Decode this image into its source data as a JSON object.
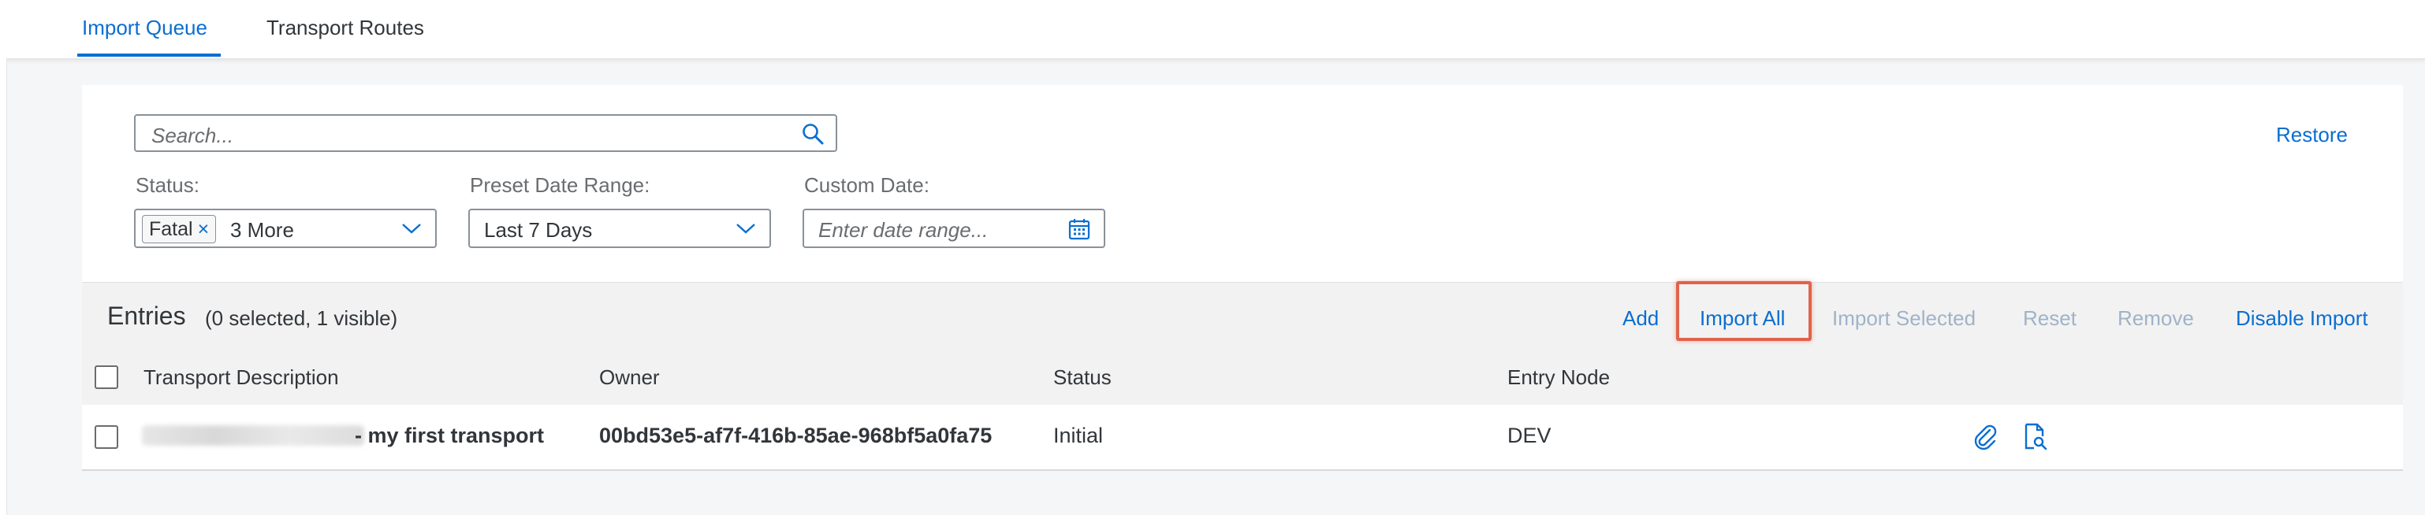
{
  "tabs": {
    "import_queue": "Import Queue",
    "transport_routes": "Transport Routes"
  },
  "filters": {
    "search_placeholder": "Search...",
    "restore": "Restore",
    "status_label": "Status:",
    "status_token": "Fatal",
    "status_token_remove": "×",
    "status_more": "3 More",
    "preset_label": "Preset Date Range:",
    "preset_value": "Last 7 Days",
    "custom_label": "Custom Date:",
    "custom_placeholder": "Enter date range..."
  },
  "entries": {
    "title": "Entries",
    "count": "(0 selected, 1 visible)",
    "actions": {
      "add": "Add",
      "import_all": "Import All",
      "import_selected": "Import Selected",
      "reset": "Reset",
      "remove": "Remove",
      "disable_import": "Disable Import"
    }
  },
  "table": {
    "columns": {
      "description": "Transport Description",
      "owner": "Owner",
      "status": "Status",
      "entry_node": "Entry Node"
    },
    "rows": [
      {
        "description": "- my first transport",
        "owner": "00bd53e5-af7f-416b-85ae-968bf5a0fa75",
        "status": "Initial",
        "entry_node": "DEV"
      }
    ]
  },
  "icons": {
    "search": "search-icon",
    "chevron": "chevron-down-icon",
    "calendar": "calendar-icon",
    "attachment": "paperclip-icon",
    "details": "document-search-icon"
  },
  "colors": {
    "accent": "#0a6ed1",
    "disabled": "#9fb3c8",
    "highlight": "#e0634c"
  }
}
